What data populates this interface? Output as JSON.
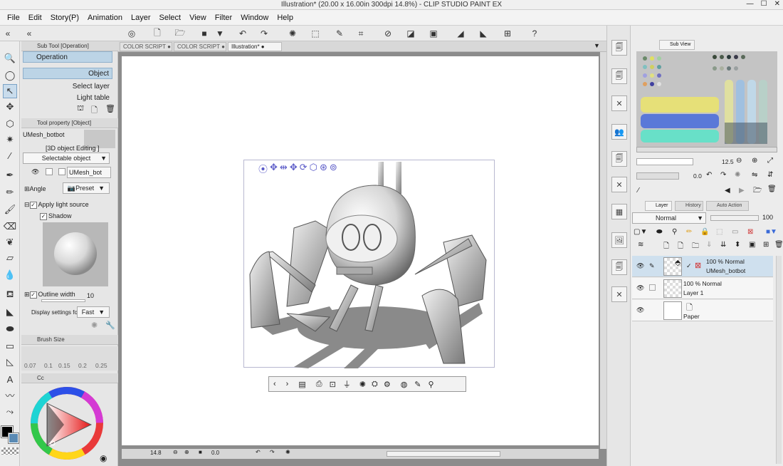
{
  "window": {
    "title": "Illustration* (20.00 x 16.00in 300dpi 14.8%) - CLIP STUDIO PAINT EX",
    "minimize": "—",
    "maximize": "☐",
    "close": "✕"
  },
  "menu": [
    "File",
    "Edit",
    "Story(P)",
    "Animation",
    "Layer",
    "Select",
    "View",
    "Filter",
    "Window",
    "Help"
  ],
  "doc_tabs": [
    "COLOR SCRIPT",
    "COLOR SCRIPT",
    "Illustration*"
  ],
  "sub_tool": {
    "header": "Sub Tool [Operation]",
    "group": "Operation",
    "items": [
      "Object",
      "Select layer",
      "Light table"
    ]
  },
  "tool_property": {
    "header": "Tool property [Object]",
    "object_name": "UMesh_botbot",
    "editing_label": "[3D object Editing ]",
    "selectable": "Selectable object",
    "layer_name": "UMesh_bot",
    "angle_label": "Angle",
    "preset_label": "Preset",
    "apply_light": "Apply light source",
    "shadow": "Shadow",
    "outline_width": "Outline width",
    "outline_value": "10",
    "display_settings": "Display settings for edi",
    "display_value": "Fast"
  },
  "brush_size": {
    "header": "Brush Size",
    "values": [
      "0.07",
      "0.1",
      "0.15",
      "0.2",
      "0.25"
    ]
  },
  "color_tab": "Cc",
  "canvas_status": {
    "zoom": "14.8",
    "rotation": "0.0"
  },
  "sub_view": {
    "tab": "Sub View",
    "zoom": "12.5",
    "rotate": "0.0"
  },
  "layer_panel": {
    "tabs": [
      "Layer",
      "History",
      "Auto Action"
    ],
    "blend_mode": "Normal",
    "opacity": "100",
    "layers": [
      {
        "line1": "100 % Normal",
        "line2": "UMesh_botbot",
        "selected": true
      },
      {
        "line1": "100 % Normal",
        "line2": "Layer 1",
        "selected": false
      },
      {
        "line1": "",
        "line2": "Paper",
        "selected": false
      }
    ]
  },
  "colors": {
    "selection": "#c9dcec",
    "canvas_bg": "#8c8c8c",
    "gizmo": "#5a5ac8"
  }
}
